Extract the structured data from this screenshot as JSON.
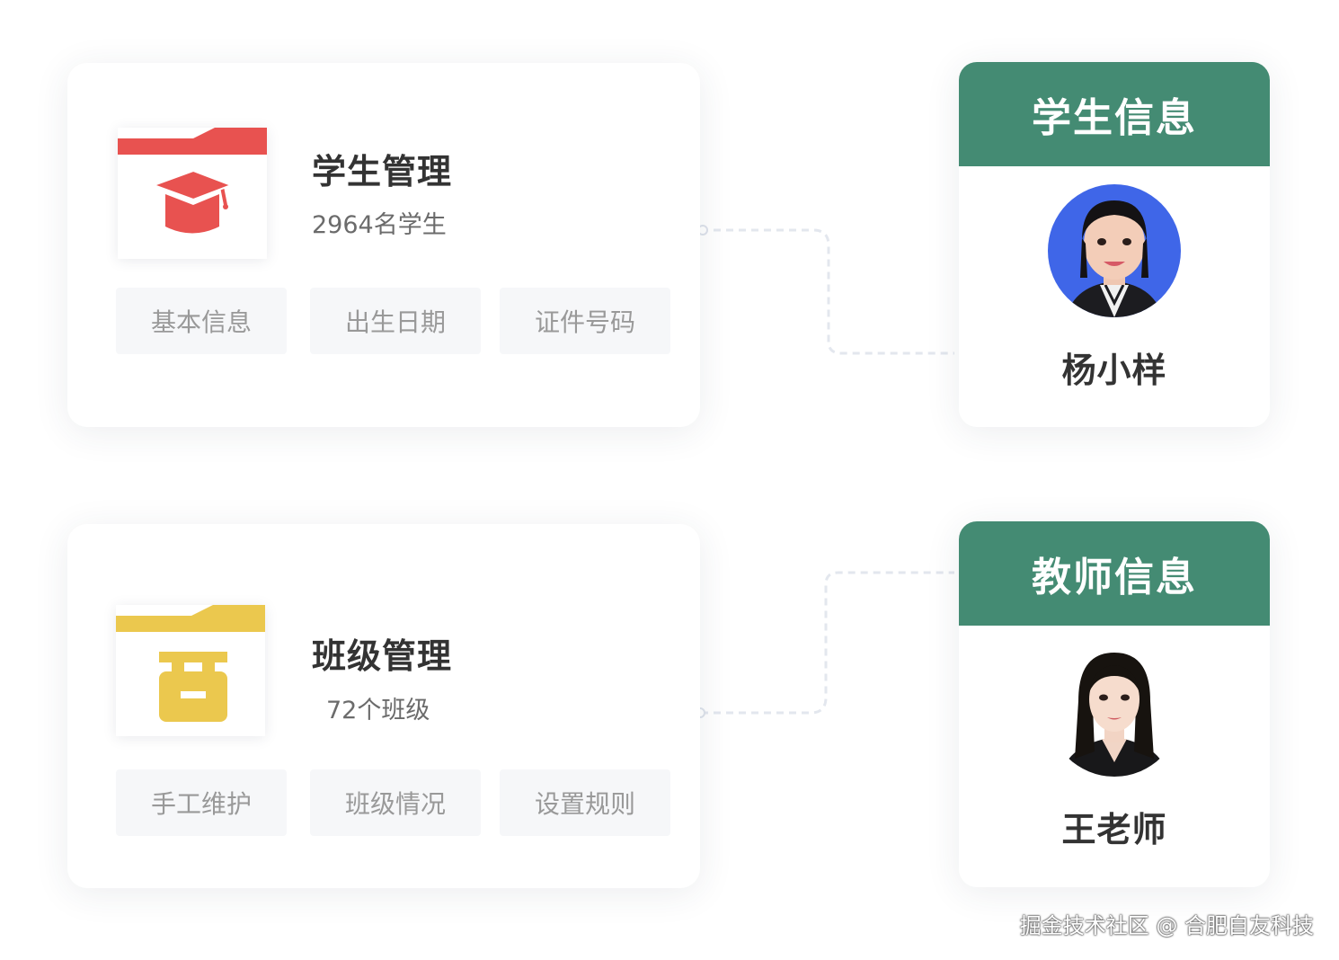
{
  "student_mgmt": {
    "title": "学生管理",
    "subtitle": "2964名学生",
    "icon": "graduation-cap-icon",
    "accent": "#e85250",
    "actions": [
      "基本信息",
      "出生日期",
      "证件号码"
    ]
  },
  "class_mgmt": {
    "title": "班级管理",
    "subtitle": "72个班级",
    "icon": "classroom-icon",
    "accent": "#ebc84e",
    "actions": [
      "手工维护",
      "班级情况",
      "设置规则"
    ]
  },
  "student_info": {
    "header": "学生信息",
    "name": "杨小样",
    "header_color": "#448b73"
  },
  "teacher_info": {
    "header": "教师信息",
    "name": "王老师",
    "header_color": "#448b73"
  },
  "watermark": "掘金技术社区 @ 合肥自友科技"
}
